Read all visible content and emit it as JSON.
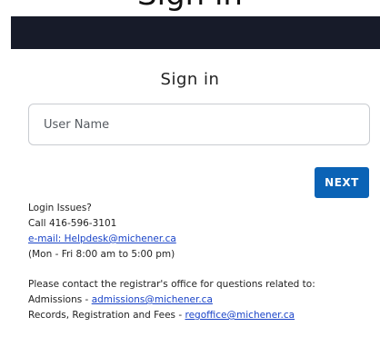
{
  "header": {
    "title_fragment": "Sign in"
  },
  "signin": {
    "title": "Sign in",
    "username_placeholder": "User Name",
    "next_label": "NEXT"
  },
  "login_issues": {
    "heading": "Login Issues?",
    "phone": "Call 416-596-3101",
    "email_link": "e-mail: Helpdesk@michener.ca",
    "hours": "(Mon - Fri 8:00 am to 5:00 pm)"
  },
  "contact": {
    "intro": "Please contact the registrar's office for questions related to:",
    "admissions_prefix": "Admissions - ",
    "admissions_email": "admissions@michener.ca",
    "records_prefix": "Records, Registration and Fees - ",
    "records_email": "regoffice@michener.ca"
  },
  "colors": {
    "banner": "#171b29",
    "primary_button": "#0b63b6",
    "link": "#1a44c8"
  }
}
